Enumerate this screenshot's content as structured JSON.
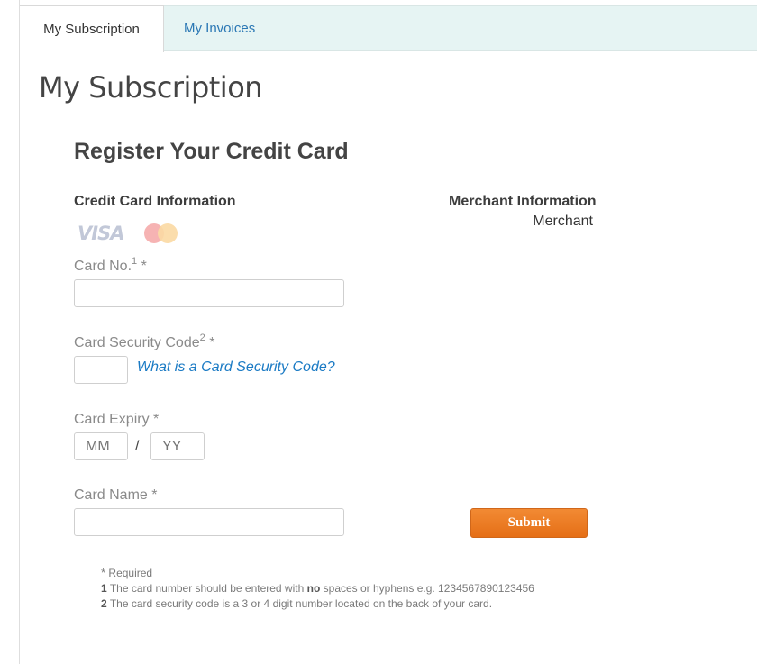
{
  "tabs": [
    {
      "label": "My Subscription",
      "active": true
    },
    {
      "label": "My Invoices",
      "active": false
    }
  ],
  "page_title": "My Subscription",
  "form": {
    "heading": "Register Your Credit Card",
    "credit_card_section": "Credit Card Information",
    "merchant_section": "Merchant Information",
    "merchant_name": "Merchant",
    "card_logos": [
      "VISA",
      "mastercard"
    ],
    "fields": {
      "card_no": {
        "label": "Card No.",
        "footnote": "1",
        "required_mark": "*",
        "value": "",
        "placeholder": ""
      },
      "security_code": {
        "label": "Card Security Code",
        "footnote": "2",
        "required_mark": "*",
        "value": "",
        "placeholder": ""
      },
      "expiry": {
        "label": "Card Expiry",
        "required_mark": "*",
        "month_placeholder": "MM",
        "year_placeholder": "YY",
        "separator": "/"
      },
      "card_name": {
        "label": "Card Name",
        "required_mark": "*",
        "value": "",
        "placeholder": ""
      }
    },
    "cvc_help_link": "What is a Card Security Code?",
    "submit_label": "Submit"
  },
  "notes": {
    "required_star": "*",
    "required_text": "Required",
    "note1_num": "1",
    "note1_pre": "The card number should be entered with",
    "note1_bold": "no",
    "note1_post": "spaces or hyphens e.g. 1234567890123456",
    "note2_num": "2",
    "note2_text": "The card security code is a 3 or 4 digit number located on the back of your card."
  },
  "colors": {
    "tab_bar_bg": "#e6f4f3",
    "link": "#1a7ac4",
    "tab_link": "#2a77b4",
    "submit_bg": "#ee7d25"
  }
}
